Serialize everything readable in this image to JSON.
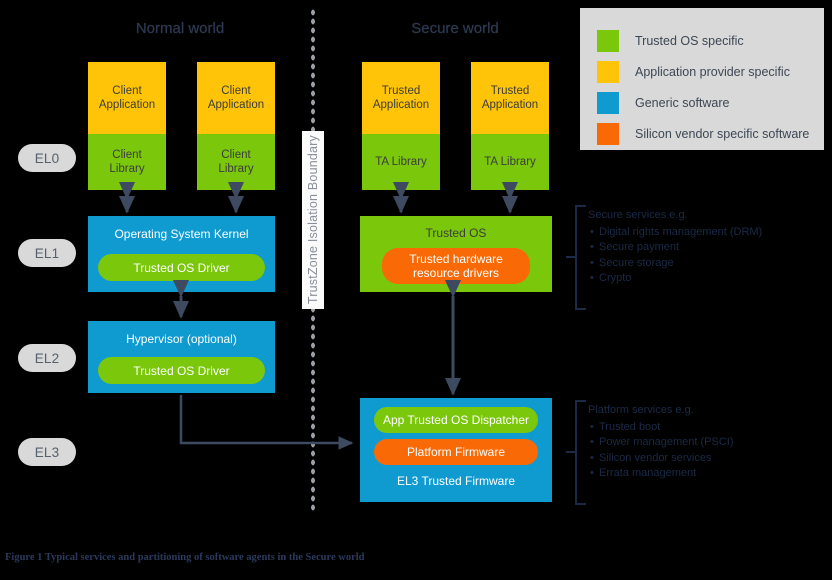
{
  "figure": {
    "caption": "Figure 1 Typical services and partitioning of software agents in the Secure world"
  },
  "worlds": {
    "normal": "Normal world",
    "secure": "Secure world"
  },
  "boundary": {
    "label": "TrustZone Isolation Boundary"
  },
  "exception_levels": [
    {
      "id": "el0",
      "label": "EL0"
    },
    {
      "id": "el1",
      "label": "EL1"
    },
    {
      "id": "el2",
      "label": "EL2"
    },
    {
      "id": "el3",
      "label": "EL3"
    }
  ],
  "normal_world": {
    "app_stacks": [
      {
        "top": "Client\nApplication",
        "bottom": "Client\nLibrary"
      },
      {
        "top": "Client\nApplication",
        "bottom": "Client\nLibrary"
      }
    ],
    "kernel": {
      "title": "Operating System Kernel",
      "driver": "Trusted OS Driver"
    },
    "hypervisor": {
      "title": "Hypervisor (optional)",
      "driver": "Trusted OS Driver"
    }
  },
  "secure_world": {
    "app_stacks": [
      {
        "top": "Trusted\nApplication",
        "bottom": "TA Library"
      },
      {
        "top": "Trusted\nApplication",
        "bottom": "TA Library"
      }
    ],
    "trusted_os": {
      "title": "Trusted OS",
      "drivers": "Trusted hardware\nresource drivers"
    },
    "firmware": {
      "dispatcher": "App Trusted OS Dispatcher",
      "platform_firmware": "Platform Firmware",
      "title": "EL3 Trusted Firmware"
    }
  },
  "annotations": [
    {
      "id": "secure-services",
      "heading": "Secure services e.g.",
      "items": [
        "Digital rights management (DRM)",
        "Secure payment",
        "Secure storage",
        "Crypto"
      ]
    },
    {
      "id": "platform-services",
      "heading": "Platform services e.g.",
      "items": [
        "Trusted boot",
        "Power management (PSCI)",
        "Silicon vendor services",
        "Errata management"
      ]
    }
  ],
  "legend": {
    "items": [
      {
        "label": "Trusted OS specific",
        "color": "#7ac70c"
      },
      {
        "label": "Application provider specific",
        "color": "#ffc408"
      },
      {
        "label": "Generic software",
        "color": "#0f9bd0"
      },
      {
        "label": "Silicon vendor specific software",
        "color": "#f96a07"
      }
    ]
  },
  "palette": {
    "green": "#7ac70c",
    "amber": "#ffc408",
    "blue": "#0f9bd0",
    "orange": "#f96a07",
    "legend_bg": "#d9d9d9",
    "pill_bg": "#d9d9d9",
    "text_dark": "#2e3b52",
    "arrow": "#3d4a60"
  }
}
